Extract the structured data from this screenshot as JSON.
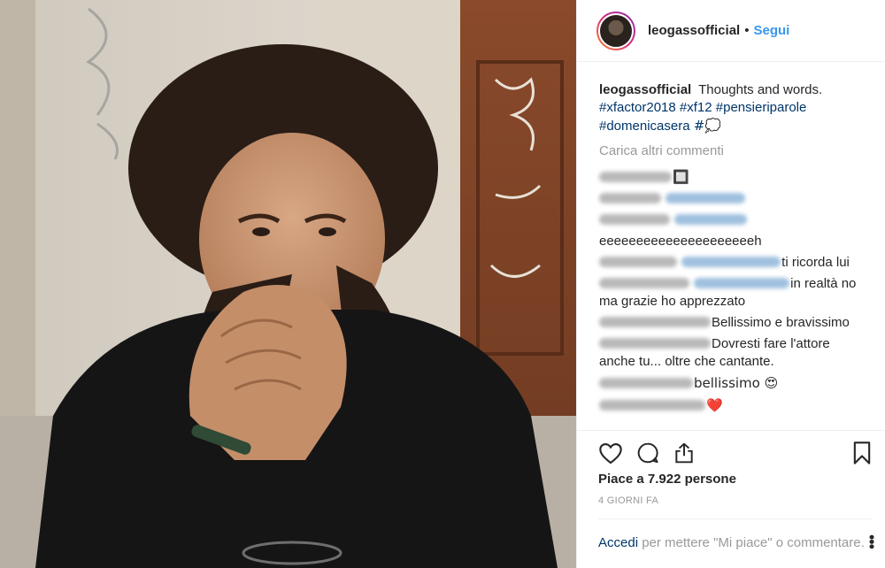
{
  "header": {
    "username": "leogassofficial",
    "separator": "•",
    "follow_label": "Segui"
  },
  "caption": {
    "username": "leogassofficial",
    "text": "Thoughts and words.",
    "hashtags": [
      "#xfactor2018",
      "#xf12",
      "#pensieriparole",
      "#domenicasera",
      "#💭"
    ]
  },
  "load_more": "Carica altri commenti",
  "comments": [
    {
      "text": "🔲",
      "blurred_user_width": 82,
      "mention_width": 0
    },
    {
      "text": "",
      "blurred_user_width": 70,
      "mention_width": 90
    },
    {
      "text": "",
      "blurred_user_width": 80,
      "mention_width": 82
    },
    {
      "text": "eeeeeeeeeeeeeeeeeeeeeh",
      "blurred_user_width": 0,
      "mention_width": 0
    },
    {
      "text": "ti ricorda lui",
      "blurred_user_width": 88,
      "mention_width": 112
    },
    {
      "text": "in realtà no ma grazie ho apprezzato",
      "blurred_user_width": 102,
      "mention_width": 108
    },
    {
      "text": "Bellissimo e bravissimo",
      "blurred_user_width": 126,
      "mention_width": 0
    },
    {
      "text": "Dovresti fare l'attore anche tu... oltre che cantante.",
      "blurred_user_width": 126,
      "mention_width": 0
    },
    {
      "text": "bellissimo 😍",
      "blurred_user_width": 106,
      "mention_width": 0
    },
    {
      "text": "❤️",
      "blurred_user_width": 120,
      "mention_width": 0
    }
  ],
  "icons": {
    "like": "heart-outline-icon",
    "comment": "speech-bubble-icon",
    "share": "share-upload-icon",
    "save": "bookmark-icon",
    "more": "more-options-icon"
  },
  "likes_text": "Piace a 7.922 persone",
  "timestamp": "4 GIORNI FA",
  "login": {
    "link": "Accedi",
    "rest": "per mettere \"Mi piace\" o commentare."
  },
  "colors": {
    "link_blue": "#3897f0",
    "hashtag": "#003569",
    "muted": "#999999"
  }
}
